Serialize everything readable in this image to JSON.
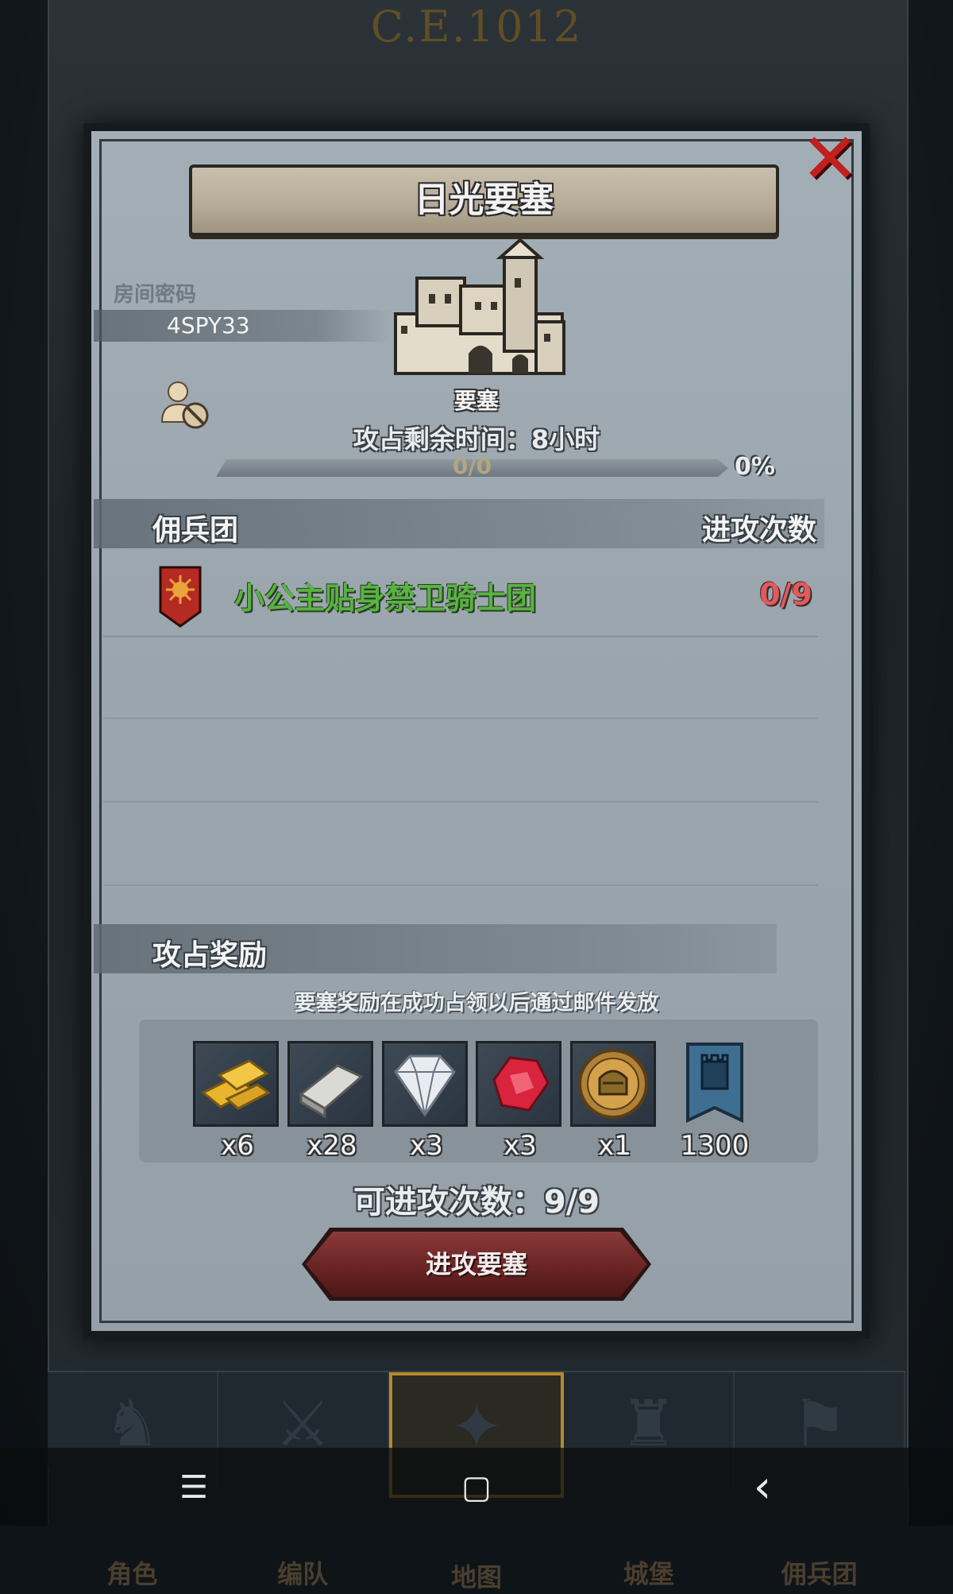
{
  "background": {
    "era_title": "C.E.1012",
    "nav_tabs": [
      {
        "label": "角色",
        "icon": "knight-icon"
      },
      {
        "label": "编队",
        "icon": "helmet-icon"
      },
      {
        "label": "地图",
        "icon": "compass-icon",
        "active": true
      },
      {
        "label": "城堡",
        "icon": "castle-icon"
      },
      {
        "label": "佣兵团",
        "icon": "mercenary-icon"
      }
    ],
    "system_nav": {
      "menu_glyph": "☰",
      "home_glyph": "▢",
      "back_glyph": "‹"
    }
  },
  "modal": {
    "title": "日光要塞",
    "room_label": "房间密码",
    "room_code": "4SPY33",
    "fortress_label": "要塞",
    "time_text": "攻占剩余时间：8小时",
    "progress": {
      "text": "0/0",
      "percent_label": "0%",
      "fraction": 0
    },
    "mercenary_header": "佣兵团",
    "attacks_header": "进攻次数",
    "mercenaries": [
      {
        "name": "小公主贴身禁卫骑士团",
        "count": "0/9"
      }
    ],
    "rewards_header": "攻占奖励",
    "rewards_note": "要塞奖励在成功占领以后通过邮件发放",
    "rewards": [
      {
        "icon": "gold-bars-icon",
        "qty": "x6"
      },
      {
        "icon": "iron-ingot-icon",
        "qty": "x28"
      },
      {
        "icon": "diamond-icon",
        "qty": "x3"
      },
      {
        "icon": "ruby-icon",
        "qty": "x3"
      },
      {
        "icon": "knight-coin-icon",
        "qty": "x1"
      },
      {
        "icon": "fortress-banner-icon",
        "qty": "1300"
      }
    ],
    "attacks_remaining": "可进攻次数：9/9",
    "attack_button": "进攻要塞",
    "close_glyph": "✕"
  },
  "colors": {
    "merc_name": "#58b342",
    "merc_count": "#e25a5a",
    "close": "#c2201c",
    "attack_button": "#6a2424"
  }
}
